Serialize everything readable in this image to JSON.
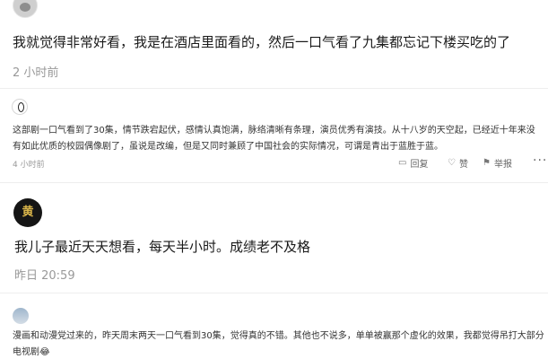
{
  "comments": [
    {
      "avatar": "user-avatar",
      "text": "我就觉得非常好看，我是在酒店里面看的，然后一口气看了九集都忘记下楼买吃的了",
      "time": "2 小时前"
    },
    {
      "avatar": "user-avatar",
      "text": "这部剧一口气看到了30集，情节跌宕起伏，感情认真饱满，脉络清晰有条理，演员优秀有演技。从十八岁的天空起，已经近十年来没有如此优质的校园偶像剧了，虽说是改编，但是又同时兼顾了中国社会的实际情况，可谓是青出于蓝胜于蓝。",
      "time": "4 小时前",
      "actions": {
        "reply_icon": "comment-icon",
        "reply": "回复",
        "like_icon": "thumbs-up-icon",
        "like": "赞",
        "report_icon": "flag-icon",
        "report": "举报",
        "more": "···"
      }
    },
    {
      "avatar": "user-avatar",
      "avatar_glyph": "黄",
      "text": "我儿子最近天天想看，每天半小时。成绩老不及格",
      "time": "昨日 20:59"
    },
    {
      "avatar": "user-avatar",
      "text": "漫画和动漫党过来的，昨天周末两天一口气看到30集，觉得真的不错。其他也不说多，单单被赢那个虚化的效果，我都觉得吊打大部分电视剧😂"
    }
  ]
}
